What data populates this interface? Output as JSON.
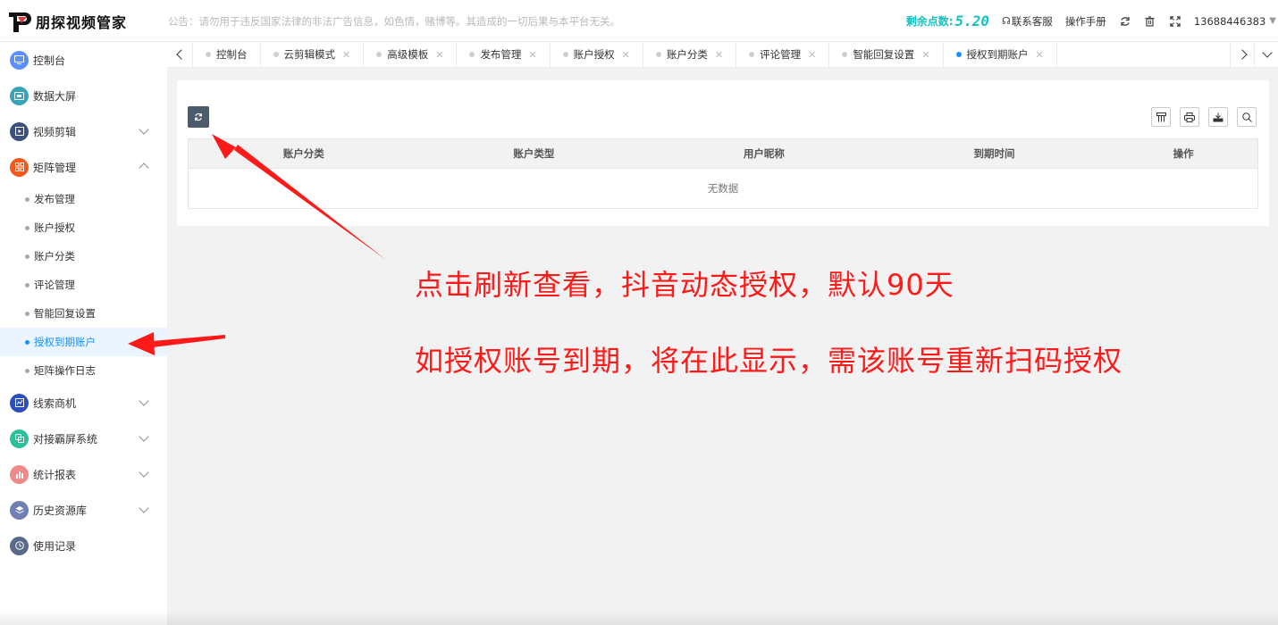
{
  "header": {
    "logo_text": "朋探视频管家",
    "notice": "公告：请勿用于违反国家法律的非法广告信息，如色情，赌博等。其造成的一切后果与本平台无关。",
    "balance_label": "剩余点数:",
    "balance_value": "5.20",
    "support_label": "联系客服",
    "manual_label": "操作手册",
    "user_phone": "13688446383",
    "accent_color": "#13c2c2"
  },
  "sidebar": {
    "items": [
      {
        "label": "控制台",
        "icon": "monitor-icon",
        "color": "#5b8ff9"
      },
      {
        "label": "数据大屏",
        "icon": "screen-icon",
        "color": "#36a3b8"
      },
      {
        "label": "视频剪辑",
        "icon": "video-edit-icon",
        "color": "#3d4f7c"
      },
      {
        "label": "矩阵管理",
        "icon": "matrix-icon",
        "color": "#f2591c"
      },
      {
        "label": "线索商机",
        "icon": "chart-icon",
        "color": "#2c4fbd"
      },
      {
        "label": "对接霸屏系统",
        "icon": "copy-icon",
        "color": "#2bbf9a"
      },
      {
        "label": "统计报表",
        "icon": "bar-chart-icon",
        "color": "#f08a8a"
      },
      {
        "label": "历史资源库",
        "icon": "layers-icon",
        "color": "#7180b3"
      },
      {
        "label": "使用记录",
        "icon": "clock-icon",
        "color": "#5a6b8a"
      }
    ],
    "sub_items": [
      {
        "label": "发布管理"
      },
      {
        "label": "账户授权"
      },
      {
        "label": "账户分类"
      },
      {
        "label": "评论管理"
      },
      {
        "label": "智能回复设置"
      },
      {
        "label": "授权到期账户"
      },
      {
        "label": "矩阵操作日志"
      }
    ],
    "active_color": "#1890ff"
  },
  "tabs": [
    {
      "label": "控制台",
      "closable": false
    },
    {
      "label": "云剪辑模式",
      "closable": true
    },
    {
      "label": "高级模板",
      "closable": true
    },
    {
      "label": "发布管理",
      "closable": true
    },
    {
      "label": "账户授权",
      "closable": true
    },
    {
      "label": "账户分类",
      "closable": true
    },
    {
      "label": "评论管理",
      "closable": true
    },
    {
      "label": "智能回复设置",
      "closable": true
    },
    {
      "label": "授权到期账户",
      "closable": true,
      "active": true
    }
  ],
  "table": {
    "columns": [
      "账户分类",
      "账户类型",
      "用户昵称",
      "到期时间",
      "操作"
    ],
    "empty_text": "无数据"
  },
  "annotations": {
    "line1": "点击刷新查看，抖音动态授权，默认90天",
    "line2": "如授权账号到期，将在此显示，需该账号重新扫码授权",
    "color": "#ff1a1a"
  }
}
